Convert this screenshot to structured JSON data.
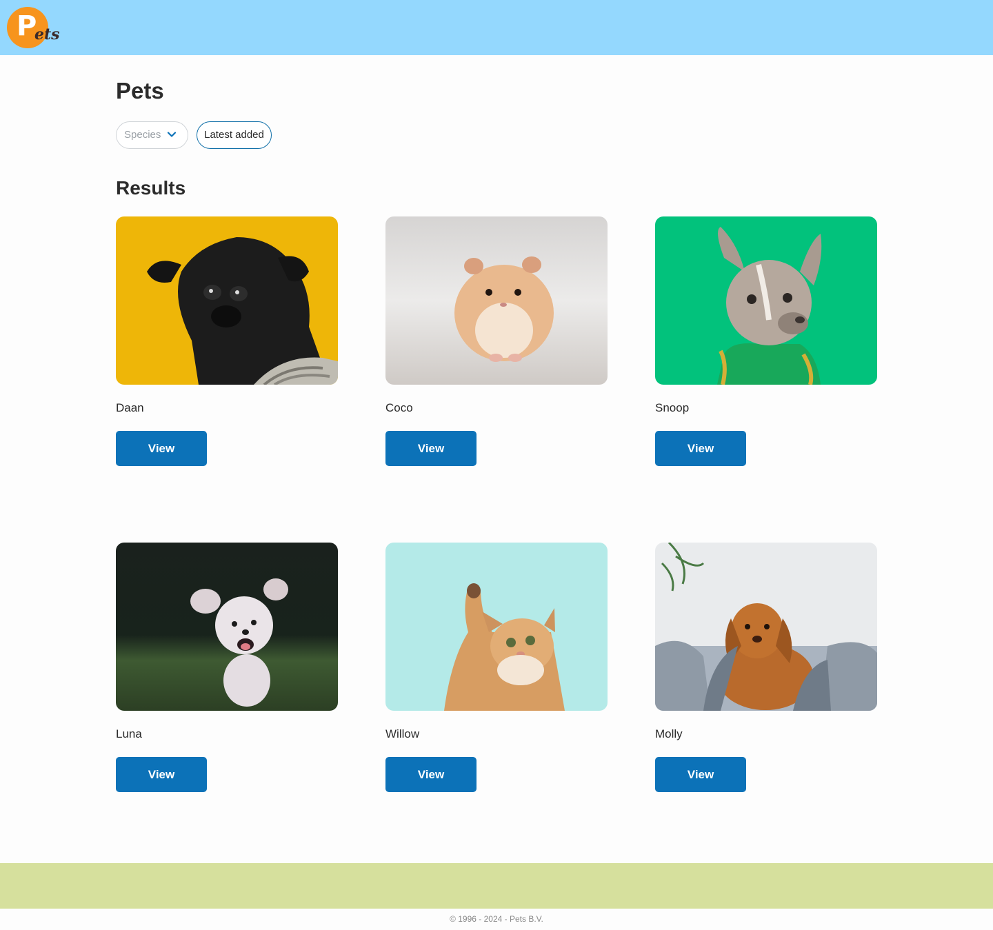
{
  "header": {
    "logo_initial": "P",
    "logo_suffix": "ets",
    "logo_color": "#f7941d",
    "background": "#94d8fe"
  },
  "main": {
    "title": "Pets",
    "filters": {
      "species_placeholder": "Species",
      "sort_label": "Latest added"
    },
    "results_title": "Results",
    "pets": [
      {
        "name": "Daan",
        "button": "View",
        "photo": "black pug on yellow background"
      },
      {
        "name": "Coco",
        "button": "View",
        "photo": "hamster standing on floor"
      },
      {
        "name": "Snoop",
        "button": "View",
        "photo": "french bulldog with gold chain on green background"
      },
      {
        "name": "Luna",
        "button": "View",
        "photo": "white poodle running on grass"
      },
      {
        "name": "Willow",
        "button": "View",
        "photo": "kitten reaching up on turquoise background"
      },
      {
        "name": "Molly",
        "button": "View",
        "photo": "brown dog under blanket on bed"
      }
    ]
  },
  "footer": {
    "copyright": "© 1996 - 2024 - Pets B.V.",
    "band_color": "#d6e09d"
  },
  "accent_color": "#0c72b8"
}
